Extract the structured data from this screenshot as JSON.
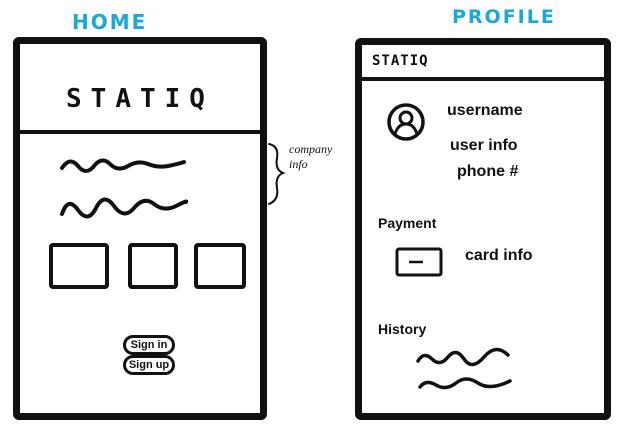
{
  "home": {
    "screen_title": "HOME",
    "logo": "STATIQ",
    "annotation_line1": "company",
    "annotation_line2": "info",
    "buttons": {
      "sign_in": "Sign in",
      "sign_up": "Sign up"
    }
  },
  "profile": {
    "screen_title": "PROFILE",
    "logo": "STATIQ",
    "user": {
      "username": "username",
      "userinfo": "user info",
      "phone": "phone #"
    },
    "payment": {
      "heading": "Payment",
      "card": "card info"
    },
    "history": {
      "heading": "History"
    }
  },
  "colors": {
    "screen_title": "#1aa9d6",
    "ink": "#111111"
  },
  "icons": [
    "avatar-icon",
    "card-icon"
  ]
}
